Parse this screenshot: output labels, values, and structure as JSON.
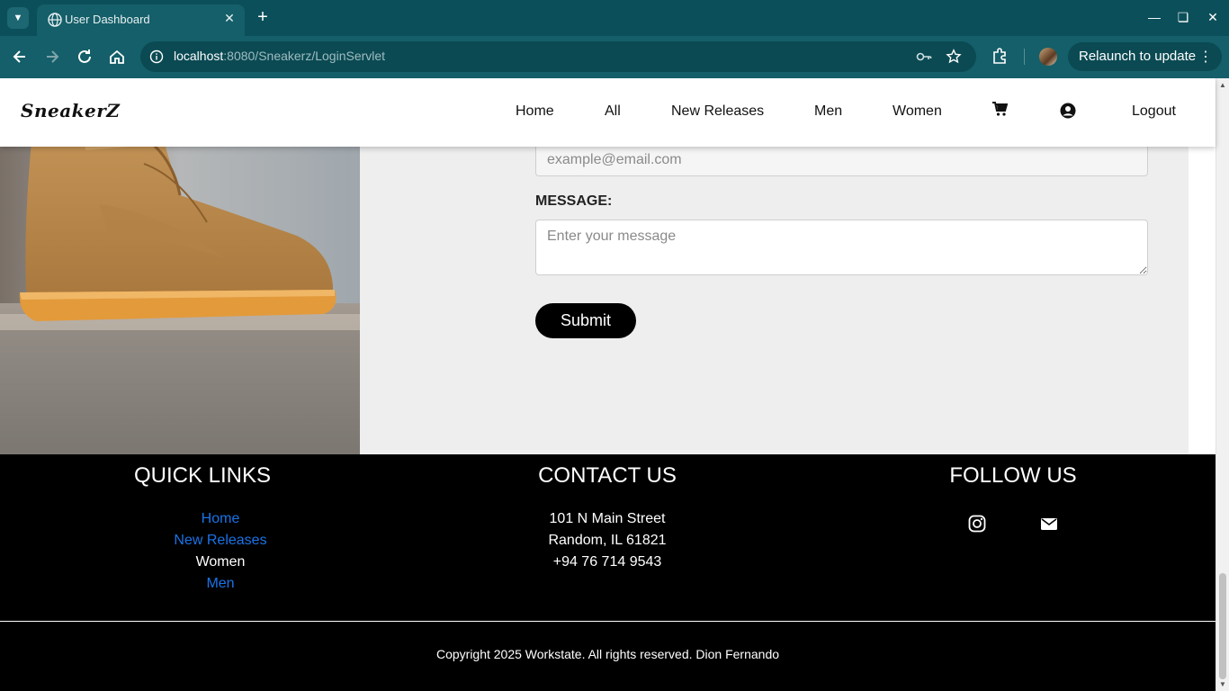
{
  "browser": {
    "tab_title": "User Dashboard",
    "url_host": "localhost",
    "url_path": ":8080/Sneakerz/LoginServlet",
    "relaunch_label": "Relaunch to update",
    "tab_bar_color": "#0b4f5a",
    "toolbar_color": "#145f69"
  },
  "site": {
    "logo": "SneakerZ",
    "nav": {
      "home": "Home",
      "all": "All",
      "new_releases": "New Releases",
      "men": "Men",
      "women": "Women",
      "logout": "Logout"
    }
  },
  "contact_form": {
    "email_placeholder": "example@email.com",
    "message_label": "MESSAGE:",
    "message_placeholder": "Enter your message",
    "submit_label": "Submit"
  },
  "footer": {
    "quick_links": {
      "heading": "QUICK LINKS",
      "items": [
        "Home",
        "New Releases",
        "Women",
        "Men"
      ]
    },
    "contact": {
      "heading": "CONTACT US",
      "address_line1": "101 N Main Street",
      "address_line2": "Random, IL 61821",
      "phone": "+94 76 714 9543"
    },
    "follow": {
      "heading": "FOLLOW US",
      "icons": [
        "instagram-icon",
        "mail-icon"
      ]
    },
    "copyright": "Copyright 2025 Workstate. All rights reserved. Dion Fernando"
  }
}
